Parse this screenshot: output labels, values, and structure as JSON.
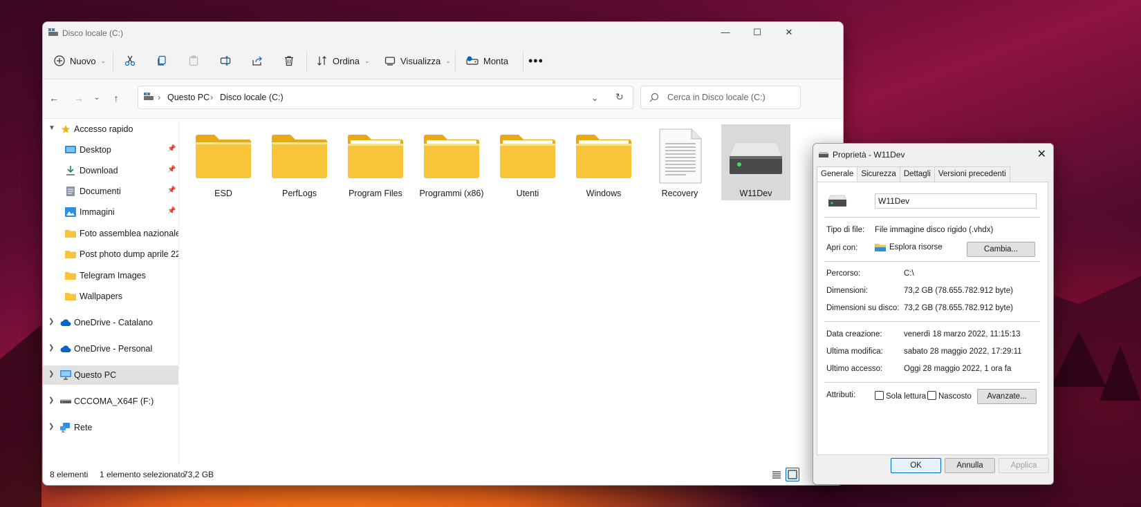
{
  "explorer": {
    "title": "Disco locale (C:)",
    "toolbar": {
      "new_label": "Nuovo",
      "sort_label": "Ordina",
      "view_label": "Visualizza",
      "mount_label": "Monta"
    },
    "breadcrumb": [
      "Questo PC",
      "Disco locale (C:)"
    ],
    "search_placeholder": "Cerca in Disco locale (C:)",
    "sidebar": {
      "quick_access": "Accesso rapido",
      "quick_items": [
        {
          "label": "Desktop",
          "pinned": true
        },
        {
          "label": "Download",
          "pinned": true
        },
        {
          "label": "Documenti",
          "pinned": true
        },
        {
          "label": "Immagini",
          "pinned": true
        },
        {
          "label": "Foto assemblea nazionale di",
          "pinned": false
        },
        {
          "label": "Post photo dump aprile 22",
          "pinned": false
        },
        {
          "label": "Telegram Images",
          "pinned": false
        },
        {
          "label": "Wallpapers",
          "pinned": false
        }
      ],
      "locations": [
        {
          "label": "OneDrive - Catalano",
          "icon": "cloud-icon"
        },
        {
          "label": "OneDrive - Personal",
          "icon": "cloud-icon"
        },
        {
          "label": "Questo PC",
          "icon": "pc-icon",
          "selected": true
        },
        {
          "label": "CCCOMA_X64F (F:)",
          "icon": "drive-icon"
        },
        {
          "label": "Rete",
          "icon": "network-icon"
        }
      ]
    },
    "items": [
      {
        "name": "ESD",
        "type": "folder"
      },
      {
        "name": "PerfLogs",
        "type": "folder"
      },
      {
        "name": "Program Files",
        "type": "folder"
      },
      {
        "name": "Programmi (x86)",
        "type": "folder"
      },
      {
        "name": "Utenti",
        "type": "folder"
      },
      {
        "name": "Windows",
        "type": "folder"
      },
      {
        "name": "Recovery",
        "type": "file"
      },
      {
        "name": "W11Dev",
        "type": "vhdx",
        "selected": true
      }
    ],
    "status": {
      "count": "8 elementi",
      "selected": "1 elemento selezionato",
      "size": "73,2 GB"
    }
  },
  "properties": {
    "title": "Proprietà - W11Dev",
    "tabs": [
      "Generale",
      "Sicurezza",
      "Dettagli",
      "Versioni precedenti"
    ],
    "active_tab": "Generale",
    "name_value": "W11Dev",
    "rows": {
      "file_type_label": "Tipo di file:",
      "file_type_value": "File immagine disco rigido (.vhdx)",
      "open_with_label": "Apri con:",
      "open_with_value": "Esplora risorse",
      "change_button": "Cambia...",
      "path_label": "Percorso:",
      "path_value": "C:\\",
      "size_label": "Dimensioni:",
      "size_value": "73,2 GB (78.655.782.912 byte)",
      "disk_size_label": "Dimensioni su disco:",
      "disk_size_value": "73,2 GB (78.655.782.912 byte)",
      "created_label": "Data creazione:",
      "created_value": "venerdì 18 marzo 2022, 11:15:13",
      "modified_label": "Ultima modifica:",
      "modified_value": "sabato 28 maggio 2022, 17:29:11",
      "accessed_label": "Ultimo accesso:",
      "accessed_value": "Oggi 28 maggio 2022, 1 ora fa",
      "attributes_label": "Attributi:",
      "readonly_label": "Sola lettura",
      "hidden_label": "Nascosto",
      "advanced_button": "Avanzate..."
    },
    "buttons": {
      "ok": "OK",
      "cancel": "Annulla",
      "apply": "Applica"
    }
  },
  "colors": {
    "folder_yellow": "#f8c53a",
    "accent": "#0067c0",
    "selection": "#d9d9d9"
  }
}
